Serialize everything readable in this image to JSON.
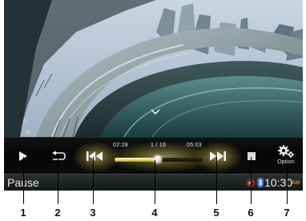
{
  "player": {
    "time_elapsed": "02:28",
    "track_position": "1 / 16",
    "time_total": "05:03",
    "progress": 0.49,
    "option_label": "Option"
  },
  "status": {
    "state": "Pause",
    "clock": "10:30",
    "ampm": "AM",
    "icons": [
      "mute-icon",
      "bluetooth-icon"
    ]
  },
  "callouts": [
    "1",
    "2",
    "3",
    "4",
    "5",
    "6",
    "7"
  ],
  "colors": {
    "accent_glow": "#e9da52",
    "ampm": "#f0a020",
    "bluetooth": "#3d8bff",
    "mute": "#d83030"
  }
}
